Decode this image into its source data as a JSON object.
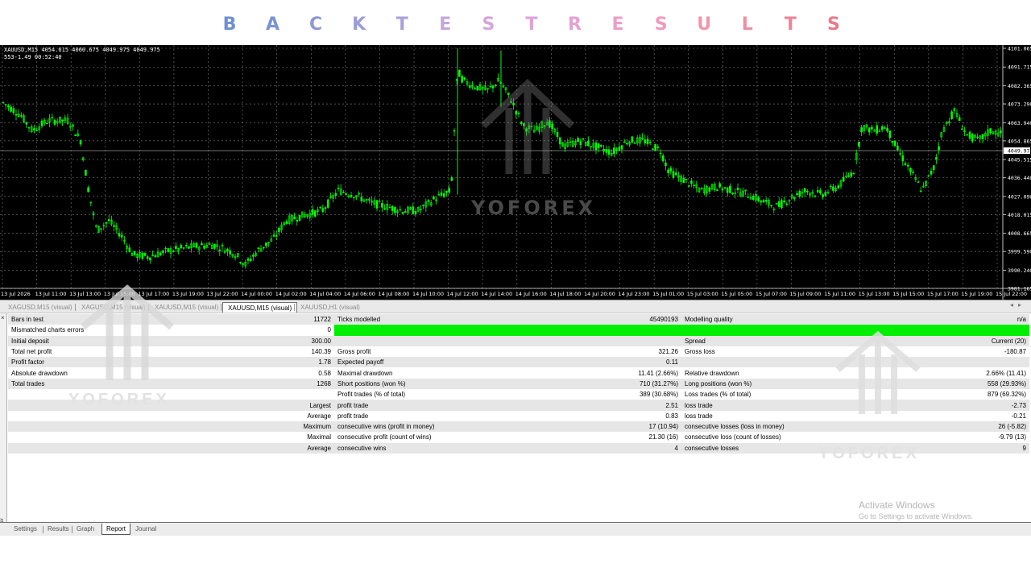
{
  "banner": {
    "letters": [
      "B",
      "A",
      "C",
      "K",
      "T",
      "E",
      "S",
      "T",
      "R",
      "E",
      "S",
      "U",
      "L",
      "T",
      "S"
    ],
    "colors": [
      "#6f8fd6",
      "#7b92d4",
      "#8c98d6",
      "#9b9cd8",
      "#aaa0da",
      "#c3a6dc",
      "#d4a5dc",
      "#dca4d8",
      "#e5a2d1",
      "#eb9fc6",
      "#ef9bbb",
      "#f096ae",
      "#ef8ea1",
      "#ec8597",
      "#e97a8b"
    ]
  },
  "chart": {
    "info_line1": "XAUUSD,M15  4054.615 4060.675 4049.975 4049.975",
    "info_line2": "553-1.49     00:52:40",
    "watermark": "YOFOREX",
    "price_labels": [
      "4101.065",
      "4091.715",
      "4082.365",
      "4073.290",
      "4063.940",
      "4054.865",
      "4049.975",
      "4045.515",
      "4036.440",
      "4027.090",
      "4018.015",
      "4008.665",
      "3999.590",
      "3990.240",
      "3981.165"
    ],
    "current_price": "4049.975",
    "time_labels": [
      "13 Jul 2026",
      "13 Jul 11:00",
      "13 Jul 13:00",
      "13 Jul 15:00",
      "13 Jul 17:00",
      "13 Jul 19:00",
      "13 Jul 22:00",
      "14 Jul 00:00",
      "14 Jul 02:00",
      "14 Jul 04:00",
      "14 Jul 06:00",
      "14 Jul 08:00",
      "14 Jul 10:00",
      "14 Jul 12:00",
      "14 Jul 14:00",
      "14 Jul 16:00",
      "14 Jul 18:00",
      "14 Jul 20:00",
      "14 Jul 23:00",
      "15 Jul 01:00",
      "15 Jul 03:00",
      "15 Jul 05:00",
      "15 Jul 07:00",
      "15 Jul 09:00",
      "15 Jul 11:00",
      "15 Jul 13:00",
      "15 Jul 15:00",
      "15 Jul 17:00",
      "15 Jul 19:00",
      "15 Jul 22:00"
    ],
    "colors": {
      "background": "#000000",
      "candle": "#00ff00",
      "grid": "#7f7f7f",
      "text": "#ffffff"
    }
  },
  "symbol_tabs": [
    {
      "label": "XAGUSD,M15 (visual)",
      "active": false
    },
    {
      "label": "XAGUSD,M15 (visual)",
      "active": false
    },
    {
      "label": "XAUUSD,M15 (visual)",
      "active": false
    },
    {
      "label": "XAUUSD,M15 (visual)",
      "active": true
    },
    {
      "label": "XAUUSD,H1 (visual)",
      "active": false
    }
  ],
  "report": {
    "rows": [
      [
        "Bars in test",
        "11722",
        "Ticks modelled",
        "45490193",
        "Modelling quality",
        "n/a"
      ],
      [
        "Mismatched charts errors",
        "0",
        "",
        "",
        "",
        ""
      ],
      [
        "Initial deposit",
        "300.00",
        "",
        "",
        "Spread",
        "Current (20)"
      ],
      [
        "Total net profit",
        "140.39",
        "Gross profit",
        "321.26",
        "Gross loss",
        "-180.87"
      ],
      [
        "Profit factor",
        "1.78",
        "Expected payoff",
        "0.11",
        "",
        ""
      ],
      [
        "Absolute drawdown",
        "0.58",
        "Maximal drawdown",
        "11.41 (2.66%)",
        "Relative drawdown",
        "2.66% (11.41)"
      ],
      [
        "Total trades",
        "1268",
        "Short positions (won %)",
        "710 (31.27%)",
        "Long positions (won %)",
        "558 (29.93%)"
      ],
      [
        "",
        "",
        "Profit trades (% of total)",
        "389 (30.68%)",
        "Loss trades (% of total)",
        "879 (69.32%)"
      ],
      [
        "",
        "Largest",
        "profit trade",
        "2.51",
        "loss trade",
        "-2.73"
      ],
      [
        "",
        "Average",
        "profit trade",
        "0.83",
        "loss trade",
        "-0.21"
      ],
      [
        "",
        "Maximum",
        "consecutive wins (profit in money)",
        "17 (10.94)",
        "consecutive losses (loss in money)",
        "26 (-5.82)"
      ],
      [
        "",
        "Maximal",
        "consecutive profit (count of wins)",
        "21.30 (16)",
        "consecutive loss (count of losses)",
        "-9.79 (13)"
      ],
      [
        "",
        "Average",
        "consecutive wins",
        "4",
        "consecutive losses",
        "9"
      ]
    ],
    "quality_bar_color": "#00ee00",
    "watermark": "YOFOREX"
  },
  "windows_notice": {
    "title": "Activate Windows",
    "subtitle": "Go to Settings to activate Windows."
  },
  "bottom_tabs": [
    {
      "label": "Settings",
      "active": false
    },
    {
      "label": "Results",
      "active": false
    },
    {
      "label": "Graph",
      "active": false
    },
    {
      "label": "Report",
      "active": true
    },
    {
      "label": "Journal",
      "active": false
    }
  ],
  "tester_label": "Tester"
}
